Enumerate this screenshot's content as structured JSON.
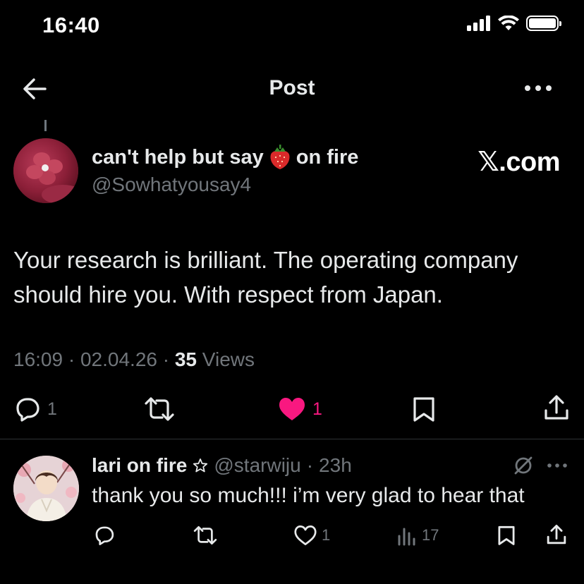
{
  "status_bar": {
    "time": "16:40"
  },
  "header": {
    "title": "Post"
  },
  "post": {
    "author_name_part1": "can't help but say",
    "author_name_part2": "on fire",
    "author_handle": "@Sowhatyousay4",
    "watermark": "𝕏.com",
    "text": "Your research is brilliant. The operating company should hire you. With respect from Japan.",
    "time": "16:09",
    "date": "02.04.26",
    "views_count": "35",
    "views_label": "Views",
    "reply_count": "1",
    "like_count": "1",
    "liked": true
  },
  "reply": {
    "author_name": "lari on fire",
    "author_handle": "@starwiju",
    "age": "23h",
    "text": "thank you so much!!! i’m very glad to hear that",
    "like_count": "1",
    "view_count": "17"
  },
  "colors": {
    "background": "#000000",
    "text": "#e7e9ea",
    "muted": "#71767b",
    "like": "#f91880",
    "divider": "#2f3336"
  },
  "icons": [
    "back-arrow-icon",
    "more-icon",
    "strawberry-icon",
    "reply-icon",
    "retweet-icon",
    "heart-icon",
    "bookmark-icon",
    "share-icon",
    "star-icon",
    "grok-icon",
    "views-icon"
  ]
}
